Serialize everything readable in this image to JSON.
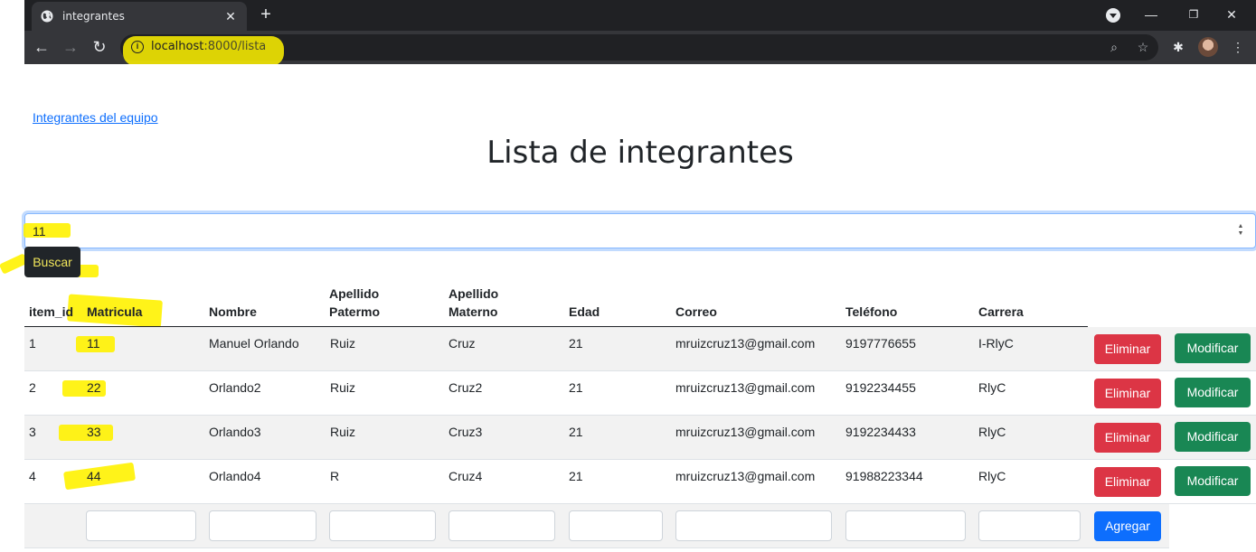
{
  "browser": {
    "tab_title": "integrantes",
    "url_host": "localhost",
    "url_rest": ":8000/lista"
  },
  "page": {
    "team_link": "Integrantes del equipo",
    "title": "Lista de integrantes",
    "search_value": "11",
    "search_button": "Buscar"
  },
  "table": {
    "headers": {
      "item_id": "item_id",
      "matricula": "Matricula",
      "nombre": "Nombre",
      "apellido_paterno_1": "Apellido",
      "apellido_paterno_2": "Patermo",
      "apellido_materno_1": "Apellido",
      "apellido_materno_2": "Materno",
      "edad": "Edad",
      "correo": "Correo",
      "telefono": "Teléfono",
      "carrera": "Carrera"
    },
    "rows": [
      {
        "item_id": "1",
        "matricula": "11",
        "nombre": "Manuel Orlando",
        "paterno": "Ruiz",
        "materno": "Cruz",
        "edad": "21",
        "correo": "mruizcruz13@gmail.com",
        "telefono": "9197776655",
        "carrera": "I-RlyC"
      },
      {
        "item_id": "2",
        "matricula": "22",
        "nombre": "Orlando2",
        "paterno": "Ruiz",
        "materno": "Cruz2",
        "edad": "21",
        "correo": "mruizcruz13@gmail.com",
        "telefono": "9192234455",
        "carrera": "RlyC"
      },
      {
        "item_id": "3",
        "matricula": "33",
        "nombre": "Orlando3",
        "paterno": "Ruiz",
        "materno": "Cruz3",
        "edad": "21",
        "correo": "mruizcruz13@gmail.com",
        "telefono": "9192234433",
        "carrera": "RlyC"
      },
      {
        "item_id": "4",
        "matricula": "44",
        "nombre": "Orlando4",
        "paterno": "R",
        "materno": "Cruz4",
        "edad": "21",
        "correo": "mruizcruz13@gmail.com",
        "telefono": "91988223344",
        "carrera": "RlyC"
      }
    ],
    "delete_label": "Eliminar",
    "edit_label": "Modificar",
    "add_label": "Agregar"
  },
  "colors": {
    "danger": "#dc3545",
    "success": "#198754",
    "primary": "#0d6efd",
    "highlight": "#fff200"
  }
}
